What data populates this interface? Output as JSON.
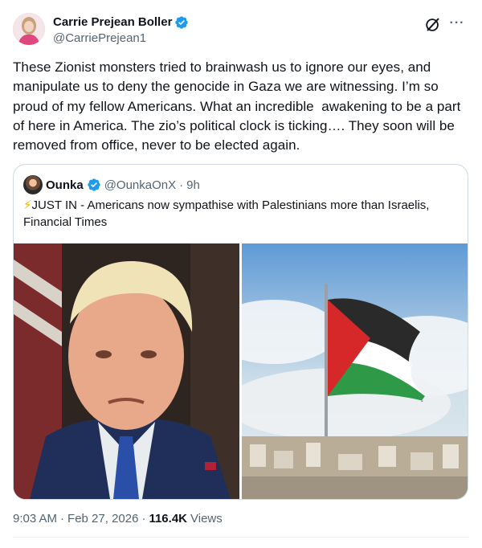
{
  "colors": {
    "text": "#0f1419",
    "secondary": "#536471",
    "border": "#cfd9de",
    "verified": "#1d9bf0",
    "bolt": "#f5b301"
  },
  "author": {
    "name": "Carrie Prejean Boller",
    "handle": "@CarriePrejean1",
    "avatar": "profile-photo",
    "verified_icon": "verified-badge-icon"
  },
  "actions": {
    "grok_icon": "grok-icon",
    "more_label": "···"
  },
  "tweet": {
    "text": "These Zionist monsters tried to brainwash us to ignore our eyes, and manipulate us to deny the genocide in Gaza we are witnessing. I’m so proud of my fellow Americans. What an incredible  awakening to be a part of here in America. The zio’s political clock is ticking…. They soon will be removed from office, never to be elected again."
  },
  "quote": {
    "name": "Ounka",
    "handle": "@OunkaOnX",
    "separator": "·",
    "time": "9h",
    "bolt": "⚡",
    "text": "JUST IN - Americans now sympathise with Palestinians more than Israelis, Financial Times",
    "images": [
      "portrait-man-suit-flag",
      "palestinian-flag-over-city"
    ]
  },
  "meta": {
    "time": "9:03 AM",
    "sep1": "·",
    "date": "Feb 27, 2026",
    "sep2": "·",
    "views_count": "116.4K",
    "views_label": "Views"
  }
}
